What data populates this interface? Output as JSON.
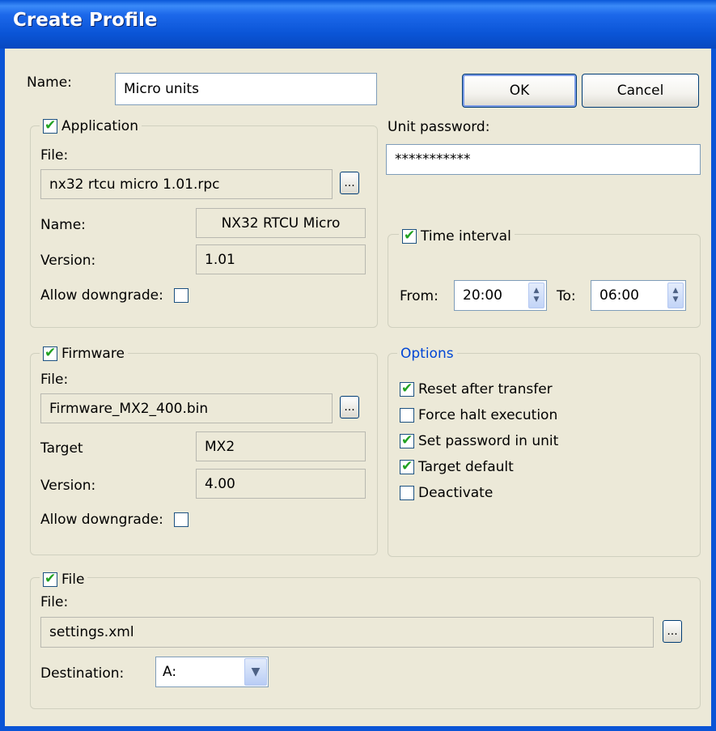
{
  "window": {
    "title": "Create Profile"
  },
  "profile": {
    "name_label": "Name:",
    "name_value": "Micro units"
  },
  "buttons": {
    "ok": "OK",
    "cancel": "Cancel"
  },
  "application": {
    "checked": true,
    "title": "Application",
    "file_label": "File:",
    "file_value": "nx32 rtcu micro 1.01.rpc",
    "browse": "...",
    "name_label": "Name:",
    "name_value": "NX32 RTCU Micro",
    "version_label": "Version:",
    "version_value": "1.01",
    "downgrade_label": "Allow downgrade:",
    "downgrade_checked": false
  },
  "password": {
    "label": "Unit password:",
    "value": "***********"
  },
  "time_interval": {
    "checked": true,
    "title": "Time interval",
    "from_label": "From:",
    "from_value": "20:00",
    "to_label": "To:",
    "to_value": "06:00"
  },
  "firmware": {
    "checked": true,
    "title": "Firmware",
    "file_label": "File:",
    "file_value": "Firmware_MX2_400.bin",
    "browse": "...",
    "target_label": "Target",
    "target_value": "MX2",
    "version_label": "Version:",
    "version_value": "4.00",
    "downgrade_label": "Allow downgrade:",
    "downgrade_checked": false
  },
  "options": {
    "title": "Options",
    "title_color": "#0046d5",
    "items": [
      {
        "label": "Reset after transfer",
        "checked": true
      },
      {
        "label": "Force halt execution",
        "checked": false
      },
      {
        "label": "Set password in unit",
        "checked": true
      },
      {
        "label": "Target default",
        "checked": true
      },
      {
        "label": "Deactivate",
        "checked": false
      }
    ]
  },
  "file_section": {
    "checked": true,
    "title": "File",
    "file_label": "File:",
    "file_value": "settings.xml",
    "browse": "...",
    "destination_label": "Destination:",
    "destination_value": "A:"
  },
  "icons": {
    "spin": "spin-arrows-icon",
    "dropdown": "chevron-down-icon",
    "check": "check-icon"
  }
}
